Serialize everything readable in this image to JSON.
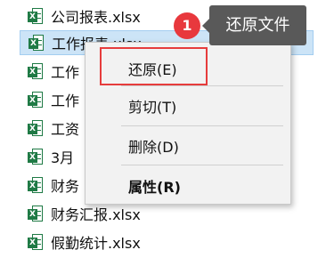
{
  "files": [
    {
      "name": "公司报表.xlsx",
      "selected": false,
      "icon": "excel-file-icon",
      "badge": "X"
    },
    {
      "name": "工作报表.xlsx",
      "selected": true,
      "icon": "excel-file-icon",
      "badge": "X"
    },
    {
      "name": "工作",
      "selected": false,
      "icon": "excel-file-icon",
      "badge": "X"
    },
    {
      "name": "工作",
      "selected": false,
      "icon": "excel-file-icon",
      "badge": "X"
    },
    {
      "name": "工资",
      "selected": false,
      "icon": "excel-file-icon",
      "badge": "X"
    },
    {
      "name": "3月",
      "selected": false,
      "icon": "excel-file-icon",
      "badge": "X"
    },
    {
      "name": "财务",
      "selected": false,
      "icon": "excel-file-icon",
      "badge": "X"
    },
    {
      "name": "财务汇报.xlsx",
      "selected": false,
      "icon": "excel-file-icon",
      "badge": "X"
    },
    {
      "name": "假勤统计.xlsx",
      "selected": false,
      "icon": "excel-file-icon",
      "badge": "X"
    }
  ],
  "context_menu": {
    "items": [
      {
        "label": "还原(E)",
        "bold": false,
        "highlighted": true
      },
      {
        "label": "剪切(T)",
        "bold": false,
        "highlighted": false
      },
      {
        "label": "删除(D)",
        "bold": false,
        "highlighted": false
      },
      {
        "label": "属性(R)",
        "bold": true,
        "highlighted": false
      }
    ]
  },
  "annotation": {
    "step_number": "1",
    "callout_text": "还原文件"
  },
  "colors": {
    "excel_green": "#1f7a45",
    "selection_bg": "#cce4f7",
    "highlight_red": "#e63c3c",
    "badge_red": "#e8383d",
    "callout_bg": "#595959"
  }
}
